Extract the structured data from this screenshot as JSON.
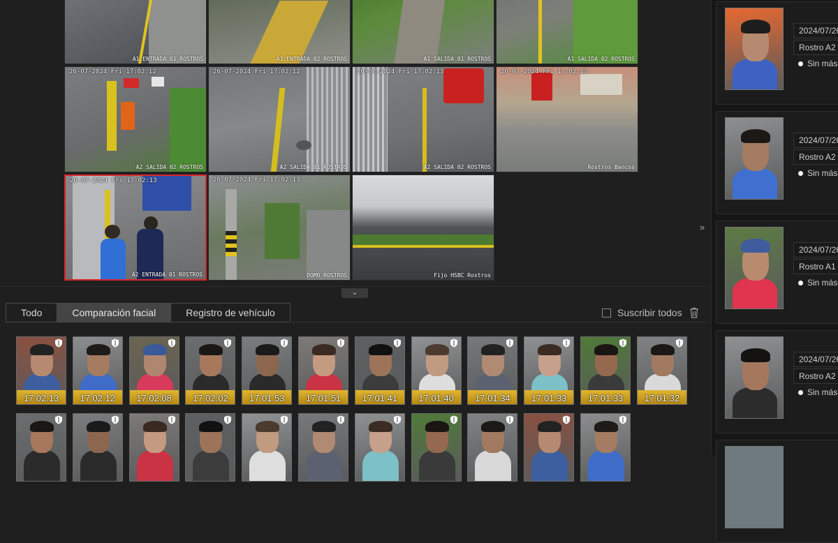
{
  "cameras": [
    {
      "name": "A1 ENTRADA 01 ROSTROS",
      "timestamp": ""
    },
    {
      "name": "A1 ENTRADA 02 ROSTROS",
      "timestamp": ""
    },
    {
      "name": "A1 SALIDA 01 ROSTROS",
      "timestamp": ""
    },
    {
      "name": "A1 SALIDA 02 ROSTROS",
      "timestamp": ""
    },
    {
      "name": "A2 SALIDA 02 ROSTROS",
      "timestamp": "26-07-2024 Fri 17:02:12"
    },
    {
      "name": "A2 SALIDA 01 ROSTROS",
      "timestamp": "26-07-2024 Fri 17:02:12"
    },
    {
      "name": "A2 SALIDA 02 ROSTROS",
      "timestamp": "26-07-2024 Fri 17:02:13"
    },
    {
      "name": "Rostros Bancos",
      "timestamp": "26-07-2024 Fri 17:02:13"
    },
    {
      "name": "A2 ENTRADA 01 ROSTROS",
      "timestamp": "26-07-2024 Fri 17:02:13"
    },
    {
      "name": "DOMO ROSTROS",
      "timestamp": "26-07-2024 Fri 17:02:13"
    },
    {
      "name": "Fijo HSBC Rostros",
      "timestamp": ""
    }
  ],
  "tabs": [
    "Todo",
    "Comparación facial",
    "Registro de vehículo"
  ],
  "subscribe_label": "Suscribir todos",
  "faces_row1": [
    "17:02:13",
    "17:02:12",
    "17:02:08",
    "17:02:02",
    "17:01:53",
    "17:01:51",
    "17:01:41",
    "17:01:40",
    "17:01:34",
    "17:01:33",
    "17:01:33",
    "17:01:32"
  ],
  "right_panel": [
    {
      "date": "2024/07/26",
      "label": "Rostro A2 E",
      "mask": "Sin másc"
    },
    {
      "date": "2024/07/26",
      "label": "Rostro A2 E",
      "mask": "Sin másc"
    },
    {
      "date": "2024/07/26",
      "label": "Rostro A1 S",
      "mask": "Sin másc"
    },
    {
      "date": "2024/07/26",
      "label": "Rostro A2 S",
      "mask": "Sin másc"
    }
  ],
  "colors": {
    "accent_selected": "#d8262b",
    "time_bar": "#e0b530",
    "tab_active": "#454545"
  },
  "icons": {
    "collapse": "double-chevron-down-icon",
    "expand": "double-chevron-right-icon",
    "delete": "trash-icon",
    "shield": "shield-icon"
  }
}
